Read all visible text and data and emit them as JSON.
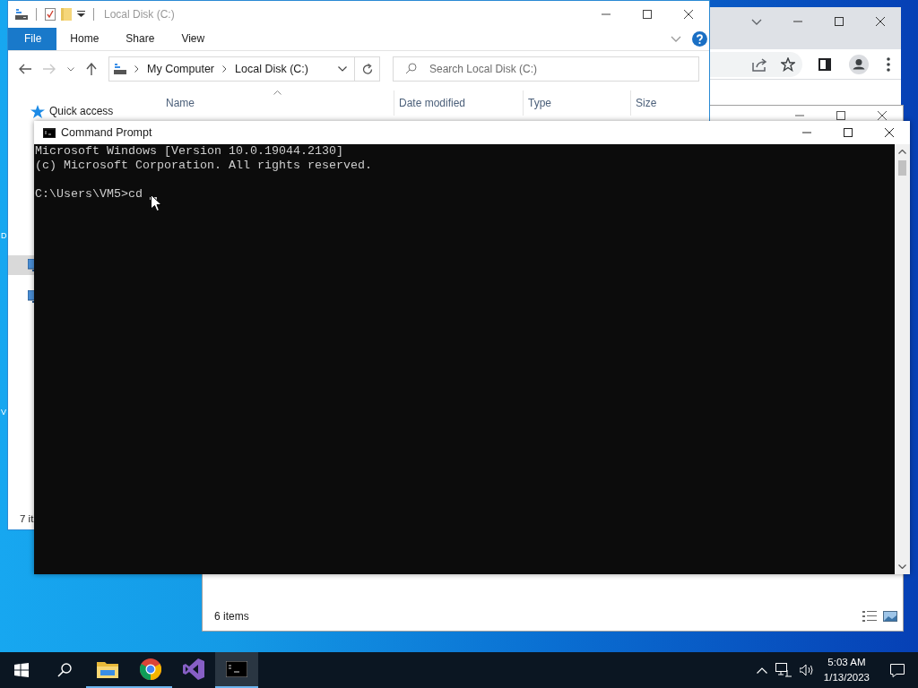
{
  "desktop": {
    "icon_labels": [
      "D",
      "V"
    ]
  },
  "explorer_main": {
    "title": "Local Disk (C:)",
    "ribbon_tabs": [
      {
        "label": "File",
        "kind": "file"
      },
      {
        "label": "Home",
        "kind": "tab"
      },
      {
        "label": "Share",
        "kind": "tab"
      },
      {
        "label": "View",
        "kind": "tab"
      }
    ],
    "address": [
      "My Computer",
      "Local Disk (C:)"
    ],
    "search": {
      "placeholder": "Search Local Disk (C:)"
    },
    "columns": [
      "Name",
      "Date modified",
      "Type",
      "Size"
    ],
    "nav": [
      {
        "label": "Quick access",
        "kind": "star",
        "selected": false
      },
      {
        "kind": "pc",
        "selected": true
      },
      {
        "kind": "pc",
        "selected": false
      }
    ],
    "status": "7 it"
  },
  "explorer_behind": {
    "status": "6 items"
  },
  "command_prompt": {
    "title": "Command Prompt",
    "output": [
      "Microsoft Windows [Version 10.0.19044.2130]",
      "(c) Microsoft Corporation. All rights reserved."
    ],
    "prompt_line": "C:\\Users\\VM5>cd"
  },
  "taskbar": {
    "apps": [
      {
        "kind": "explorer",
        "running": true,
        "selected": false
      },
      {
        "kind": "chrome",
        "running": true,
        "selected": false
      },
      {
        "kind": "vs",
        "running": false,
        "selected": false
      },
      {
        "kind": "cmd",
        "running": true,
        "selected": true
      }
    ],
    "time": "5:03 AM",
    "date": "1/13/2023"
  }
}
